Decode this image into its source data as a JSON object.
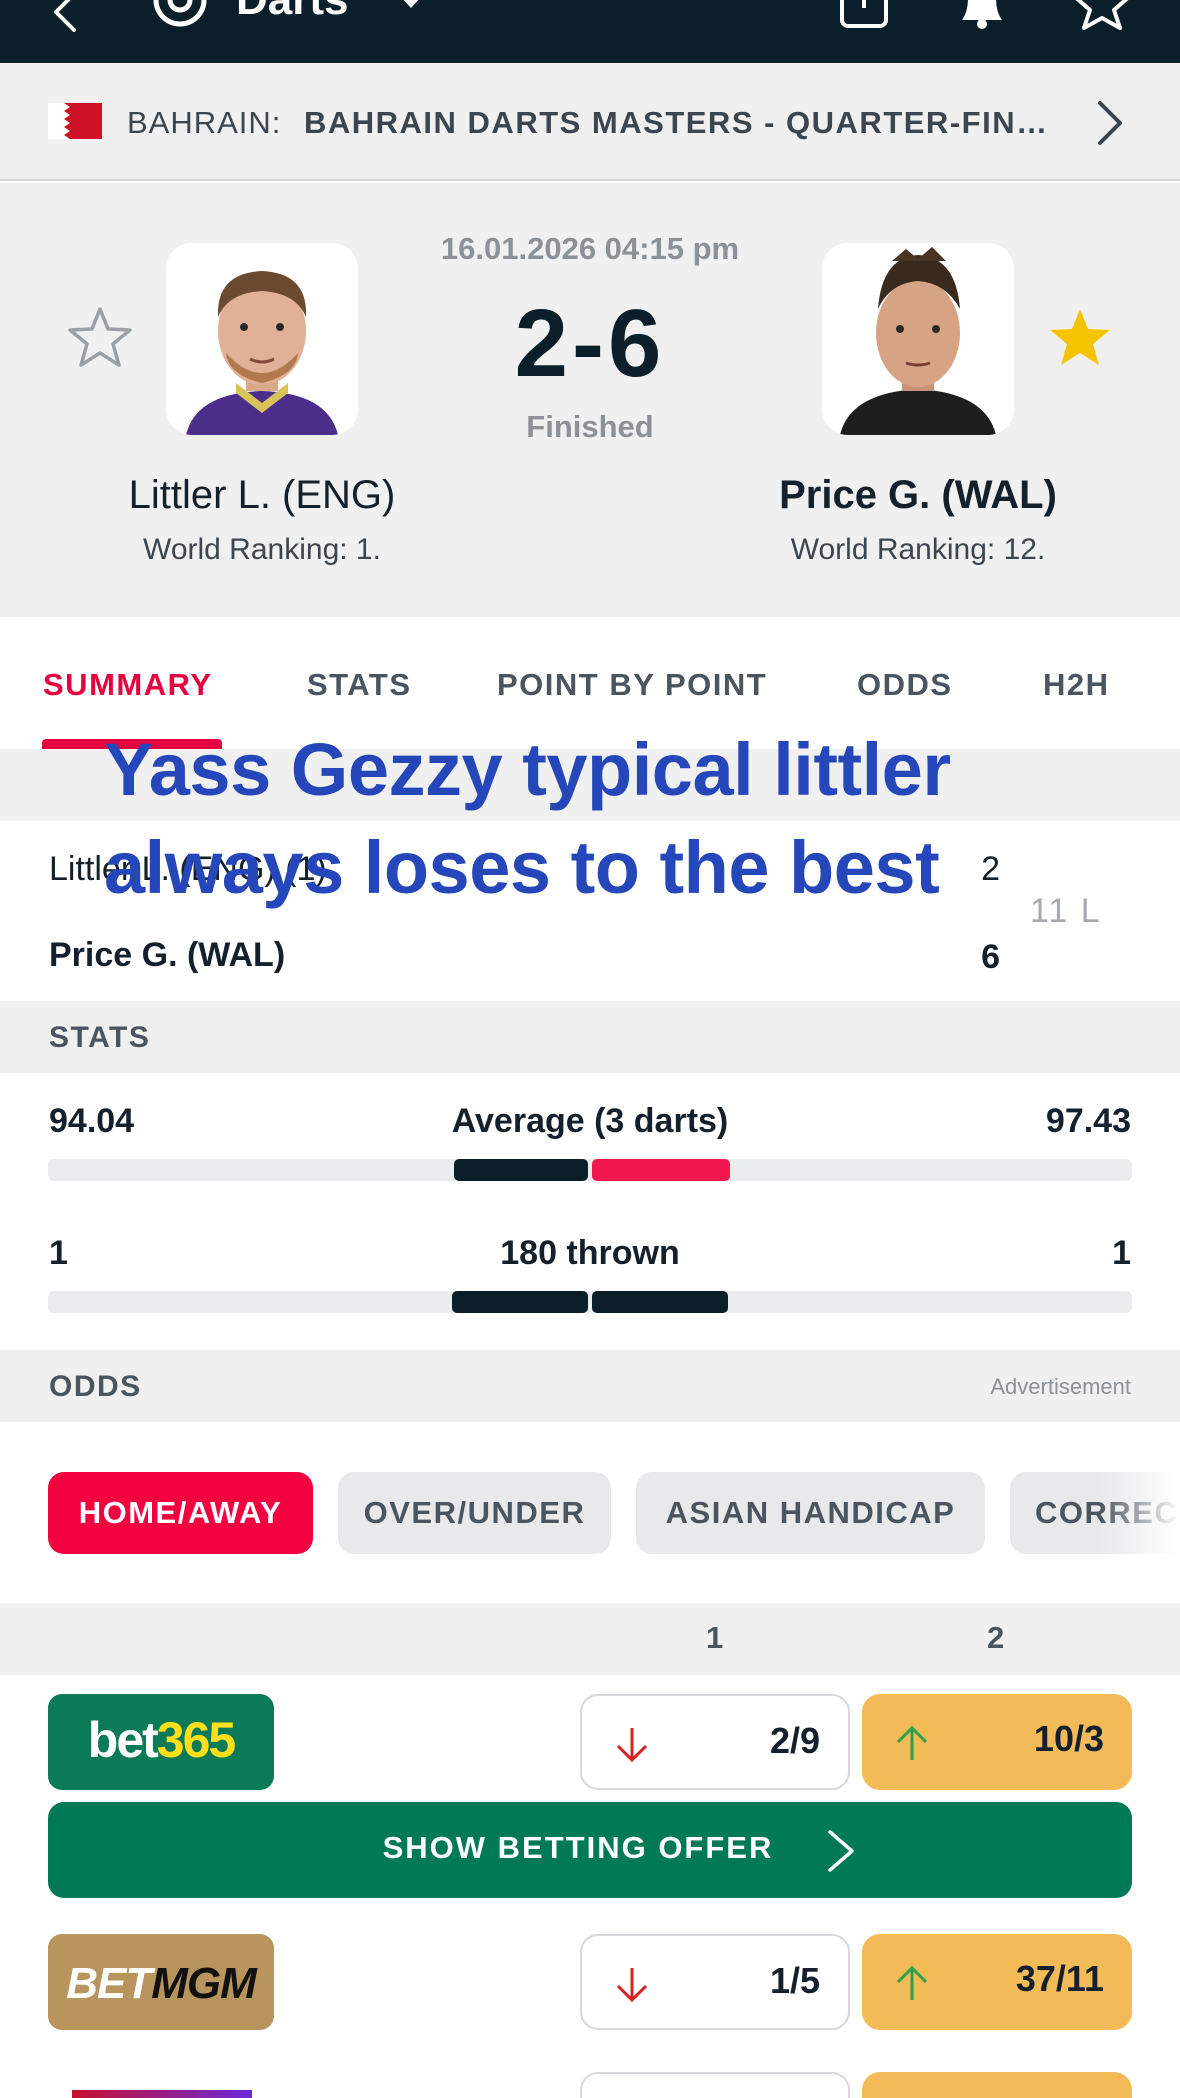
{
  "topbar": {
    "sport": "Darts",
    "icons": [
      "back-arrow-icon",
      "darts-icon",
      "dropdown-caret-icon",
      "share-icon",
      "bell-icon",
      "star-icon"
    ]
  },
  "tournament": {
    "country": "BAHRAIN:",
    "event": "BAHRAIN DARTS MASTERS - QUARTER-FINA..."
  },
  "match": {
    "datetime": "16.01.2026 04:15 pm",
    "score": "2-6",
    "status": "Finished",
    "home": {
      "name": "Littler L. (ENG)",
      "ranking": "World Ranking: 1.",
      "favorite": false
    },
    "away": {
      "name": "Price G. (WAL)",
      "ranking": "World Ranking: 12.",
      "favorite": true
    }
  },
  "tabs": [
    "SUMMARY",
    "STATS",
    "POINT BY POINT",
    "ODDS",
    "H2H"
  ],
  "summary": {
    "rows": [
      {
        "name": "Littler L. (ENG) (1)",
        "score": "2"
      },
      {
        "name": "Price G. (WAL)",
        "score": "6"
      }
    ],
    "extra": "11 L"
  },
  "overlay_caption": {
    "line1": "Yass Gezzy typical littler",
    "line2": "always loses to the best"
  },
  "stats": {
    "title": "STATS",
    "items": [
      {
        "name": "Average (3 darts)",
        "home": "94.04",
        "away": "97.43",
        "home_share": 0.491,
        "away_share": 0.509
      },
      {
        "name": "180 thrown",
        "home": "1",
        "away": "1",
        "home_share": 0.5,
        "away_share": 0.5
      }
    ]
  },
  "odds": {
    "title": "ODDS",
    "ad_label": "Advertisement",
    "filters": [
      "HOME/AWAY",
      "OVER/UNDER",
      "ASIAN HANDICAP",
      "CORREC"
    ],
    "col1": "1",
    "col2": "2",
    "bookmakers": [
      {
        "name": "bet365",
        "name_part1": "bet",
        "name_part2": "365",
        "odd1": "2/9",
        "odd1_trend": "down",
        "odd2": "10/3",
        "odd2_trend": "up",
        "offer": "SHOW BETTING OFFER"
      },
      {
        "name": "BETMGM",
        "name_part1": "BET",
        "name_part2": "MGM",
        "odd1": "1/5",
        "odd1_trend": "down",
        "odd2": "37/11",
        "odd2_trend": "up"
      }
    ]
  },
  "colors": {
    "topbar": "#0b1f2a",
    "accent": "#e7003f",
    "bar_home": "#0b1f2a",
    "bar_away_avg": "#f2184f",
    "bar_away_180": "#0b1f2a",
    "favorite_star": "#f5c400",
    "bet365_green": "#0b7a56",
    "betmgm_gold": "#b7955d",
    "odds_up_bg": "#f2bb57",
    "caption": "#2547b9"
  }
}
